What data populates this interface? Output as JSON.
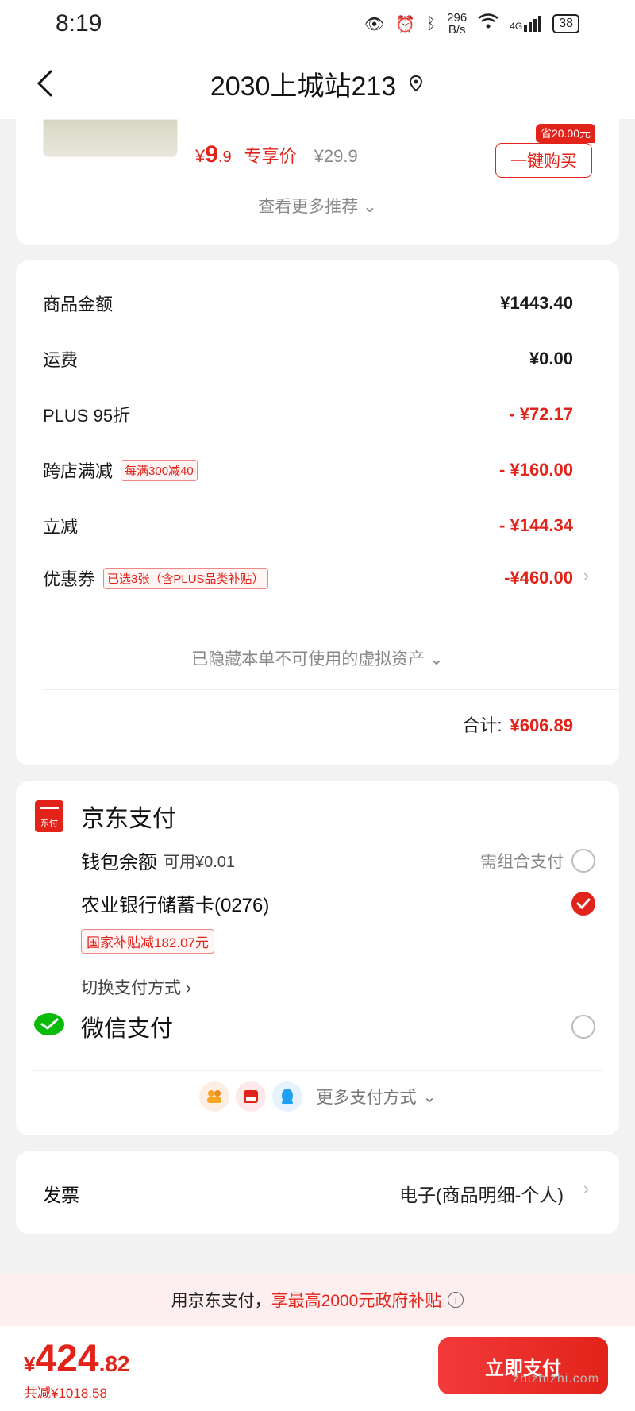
{
  "status": {
    "time": "8:19",
    "speed_top": "296",
    "speed_bottom": "B/s",
    "network": "4G",
    "battery": "38"
  },
  "nav": {
    "title": "2030上城站213"
  },
  "recommend": {
    "price_symbol": "¥",
    "price_int": "9",
    "price_dec": ".9",
    "exclusive_label": "专享价",
    "original_price": "¥29.9",
    "save_badge": "省20.00元",
    "buy_button": "一键购买",
    "see_more": "查看更多推荐"
  },
  "summary": {
    "goods_amount": {
      "label": "商品金额",
      "value": "¥1443.40"
    },
    "shipping": {
      "label": "运费",
      "value": "¥0.00"
    },
    "plus_discount": {
      "label": "PLUS 95折",
      "value": "- ¥72.17"
    },
    "cross_store": {
      "label": "跨店满减",
      "tag": "每满300减40",
      "value": "- ¥160.00"
    },
    "instant_cut": {
      "label": "立减",
      "value": "- ¥144.34"
    },
    "coupon": {
      "label": "优惠券",
      "tag": "已选3张（含PLUS品类补贴）",
      "value": "-¥460.00"
    },
    "hidden_assets": "已隐藏本单不可使用的虚拟资产",
    "total_label": "合计:",
    "total_value": "¥606.89"
  },
  "payment": {
    "jd_pay_title": "京东支付",
    "jd_logo_text": "东付",
    "wallet": {
      "label": "钱包余额",
      "available": "可用¥0.01",
      "hint": "需组合支付"
    },
    "bank_card": {
      "label": "农业银行储蓄卡(0276)",
      "subsidy": "国家补贴减182.07元"
    },
    "switch_method": "切换支付方式",
    "wechat_title": "微信支付",
    "more_methods": "更多支付方式"
  },
  "invoice": {
    "label": "发票",
    "value": "电子(商品明细-个人)"
  },
  "banner": {
    "prefix": "用京东支付，",
    "highlight": "享最高2000元政府补贴"
  },
  "footer": {
    "symbol": "¥",
    "amount_int": "424",
    "amount_dec": ".82",
    "saved": "共减¥1018.58",
    "pay_button": "立即支付"
  },
  "watermark": "zhizhizhi.com",
  "colors": {
    "accent": "#e2231a",
    "wechat": "#09bb07"
  }
}
